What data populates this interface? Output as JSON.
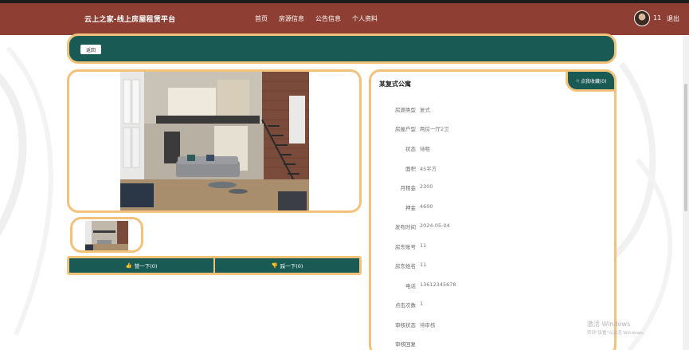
{
  "header": {
    "brand": "云上之家-线上房屋租赁平台",
    "nav": [
      "首页",
      "房源信息",
      "公告信息",
      "个人资料"
    ],
    "username": "11",
    "logout": "退出"
  },
  "toolbar": {
    "back_label": "返回"
  },
  "votes": {
    "like_label": "赞一下(0)",
    "dislike_label": "踩一下(0)"
  },
  "info": {
    "title": "某复式公寓",
    "favorite_label": "点我收藏(0)",
    "rows": [
      {
        "label": "房源类型",
        "value": "复式"
      },
      {
        "label": "房屋户型",
        "value": "两房一厅2卫"
      },
      {
        "label": "状态",
        "value": "待租"
      },
      {
        "label": "面积",
        "value": "45平方"
      },
      {
        "label": "月租金",
        "value": "2300"
      },
      {
        "label": "押金",
        "value": "4600"
      },
      {
        "label": "发布时间",
        "value": "2024-05-04"
      },
      {
        "label": "房东账号",
        "value": "11"
      },
      {
        "label": "房东姓名",
        "value": "11"
      },
      {
        "label": "电话",
        "value": "13612345678"
      },
      {
        "label": "点击次数",
        "value": "1"
      },
      {
        "label": "审核状态",
        "value": "待审核"
      },
      {
        "label": "审核回复",
        "value": ""
      }
    ]
  },
  "watermark": {
    "line1": "激活 Windows",
    "line2": "转到\"设置\"以激活 Windows。"
  },
  "colors": {
    "header": "#8e3e33",
    "teal": "#1a5a55",
    "accent_border": "#f2c27a"
  }
}
